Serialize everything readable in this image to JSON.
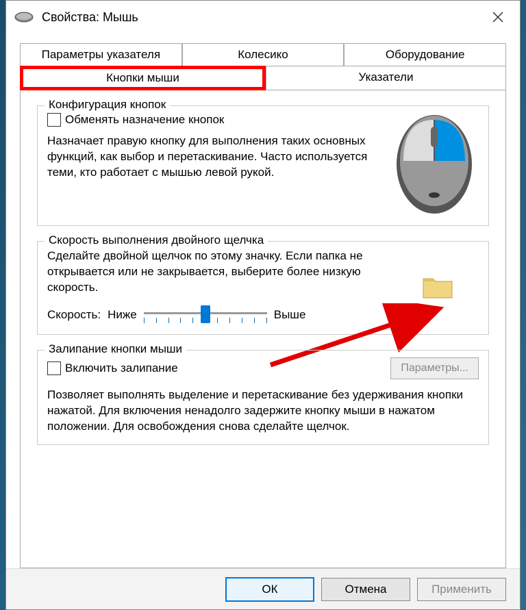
{
  "window": {
    "title": "Свойства: Мышь"
  },
  "tabs": {
    "row1": [
      "Параметры указателя",
      "Колесико",
      "Оборудование"
    ],
    "row2": [
      "Кнопки мыши",
      "Указатели"
    ]
  },
  "config": {
    "legend": "Конфигурация кнопок",
    "checkbox_label": "Обменять назначение кнопок",
    "description": "Назначает правую кнопку для выполнения таких основных функций, как выбор и перетаскивание. Часто используется теми, кто работает с мышью левой рукой."
  },
  "dblclick": {
    "legend": "Скорость выполнения двойного щелчка",
    "description": "Сделайте двойной щелчок по этому значку. Если папка не открывается или не закрывается, выберите более низкую скорость.",
    "speed_label": "Скорость:",
    "slow_label": "Ниже",
    "fast_label": "Выше"
  },
  "sticky": {
    "legend": "Залипание кнопки мыши",
    "checkbox_label": "Включить залипание",
    "params_button": "Параметры...",
    "description": "Позволяет выполнять выделение и перетаскивание без удерживания кнопки нажатой. Для включения ненадолго задержите кнопку мыши в нажатом положении. Для освобождения снова сделайте щелчок."
  },
  "footer": {
    "ok": "ОК",
    "cancel": "Отмена",
    "apply": "Применить"
  }
}
